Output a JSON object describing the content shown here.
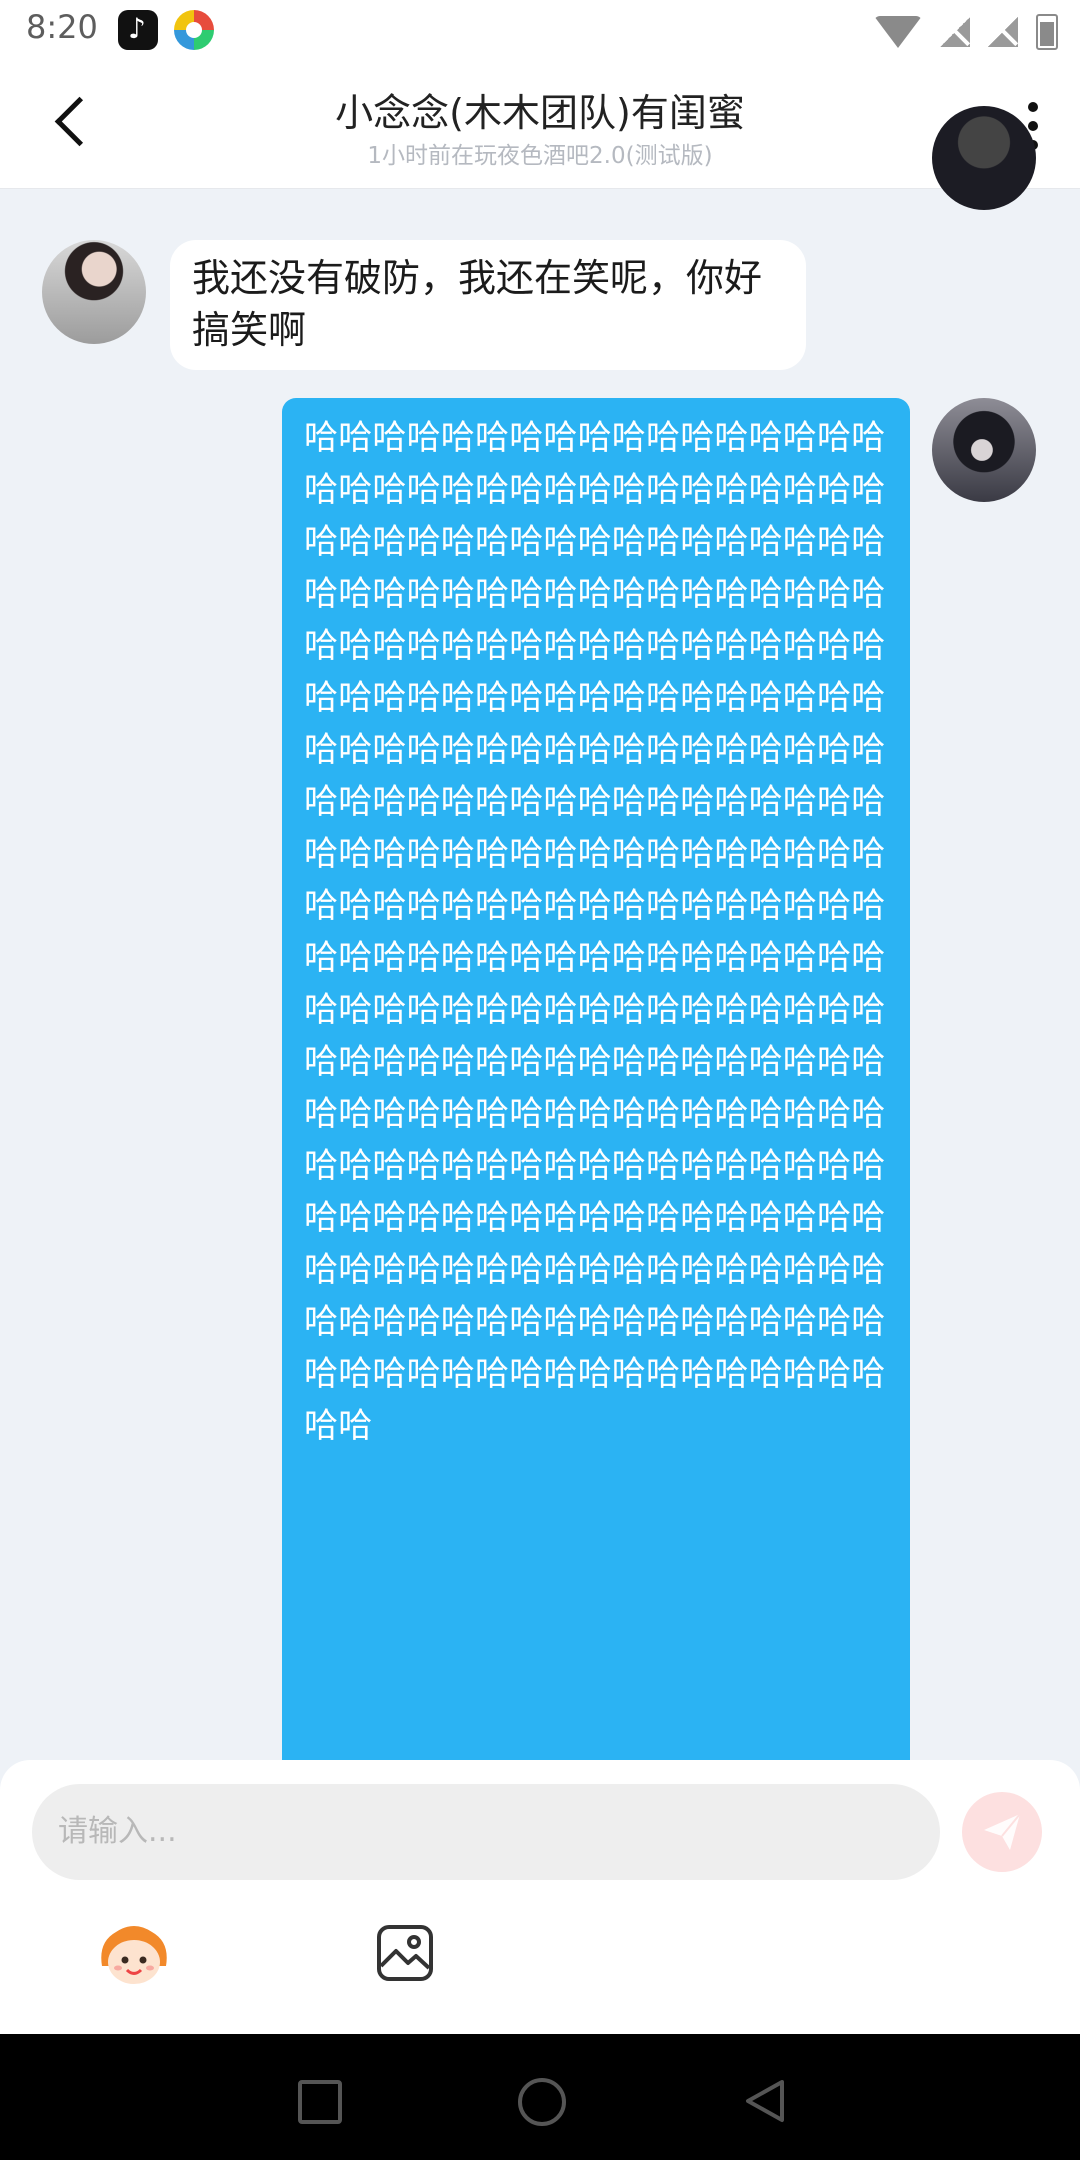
{
  "status_bar": {
    "time": "8:20",
    "app_icons": [
      "tiktok-icon",
      "pinwheel-app-icon"
    ],
    "system_icons": [
      "wifi-icon",
      "no-signal-icon",
      "no-signal-icon",
      "battery-icon"
    ]
  },
  "header": {
    "title": "小念念(木木团队)有闺蜜",
    "subtitle": "1小时前在玩夜色酒吧2.0(测试版)"
  },
  "messages": [
    {
      "side": "left",
      "text": "我还没有破防，我还在笑呢，你好搞笑啊"
    },
    {
      "side": "right",
      "text": "哈哈哈哈哈哈哈哈哈哈哈哈哈哈哈哈哈哈哈哈哈哈哈哈哈哈哈哈哈哈哈哈哈哈哈哈哈哈哈哈哈哈哈哈哈哈哈哈哈哈哈哈哈哈哈哈哈哈哈哈哈哈哈哈哈哈哈哈哈哈哈哈哈哈哈哈哈哈哈哈哈哈哈哈哈哈哈哈哈哈哈哈哈哈哈哈哈哈哈哈哈哈哈哈哈哈哈哈哈哈哈哈哈哈哈哈哈哈哈哈哈哈哈哈哈哈哈哈哈哈哈哈哈哈哈哈哈哈哈哈哈哈哈哈哈哈哈哈哈哈哈哈哈哈哈哈哈哈哈哈哈哈哈哈哈哈哈哈哈哈哈哈哈哈哈哈哈哈哈哈哈哈哈哈哈哈哈哈哈哈哈哈哈哈哈哈哈哈哈哈哈哈哈哈哈哈哈哈哈哈哈哈哈哈哈哈哈哈哈哈哈哈哈哈哈哈哈哈哈哈哈哈哈哈哈哈哈哈哈哈哈哈哈哈哈哈哈哈哈哈哈哈哈哈哈哈哈哈哈哈哈哈哈哈哈哈哈哈哈哈哈哈哈哈哈哈哈哈哈哈哈哈哈哈哈哈哈哈哈哈哈哈哈哈哈哈哈哈哈哈哈哈哈哈哈哈哈哈哈哈哈哈哈哈哈哈哈哈哈哈哈哈哈哈哈"
    }
  ],
  "input": {
    "placeholder": "请输入..."
  },
  "toolbar": {
    "buttons": [
      "emoji-icon",
      "image-icon"
    ]
  },
  "colors": {
    "sent_bubble": "#2bb3f3",
    "received_bubble": "#ffffff",
    "chat_background": "#eef2f7",
    "send_button": "#fde0e0"
  }
}
